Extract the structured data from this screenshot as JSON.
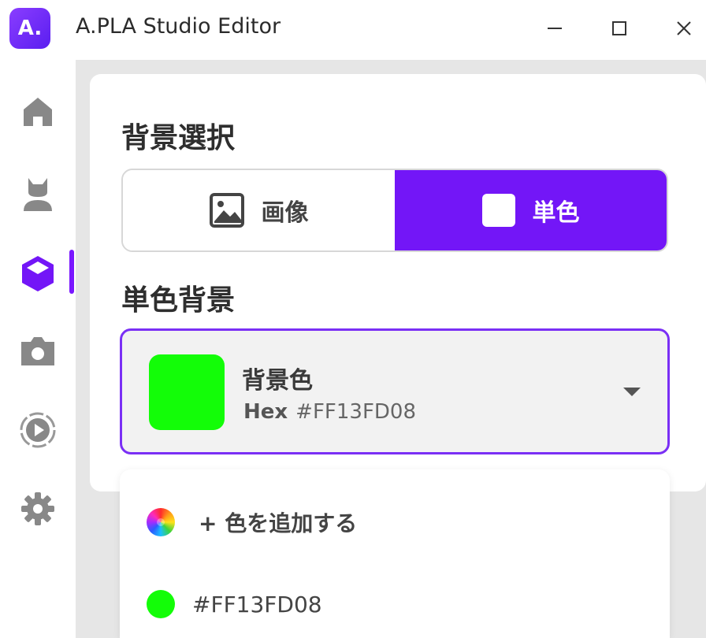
{
  "window": {
    "logo_text": "A.",
    "title": "A.PLA Studio Editor"
  },
  "sidebar": {
    "items": [
      {
        "icon": "home-icon"
      },
      {
        "icon": "avatar-icon"
      },
      {
        "icon": "cube-icon",
        "active": true
      },
      {
        "icon": "camera-icon"
      },
      {
        "icon": "play-icon"
      },
      {
        "icon": "gear-icon"
      }
    ]
  },
  "background": {
    "section_title": "背景選択",
    "options": {
      "image_label": "画像",
      "solid_label": "単色"
    },
    "selected": "solid"
  },
  "solid": {
    "section_title": "単色背景",
    "color_label": "背景色",
    "hex_prefix": "Hex",
    "hex_value": "#FF13FD08",
    "swatch_color": "#13FD08"
  },
  "dropdown": {
    "add_label": "+ 色を追加する",
    "colors": [
      {
        "label": "#FF13FD08",
        "color": "#13FD08"
      }
    ]
  },
  "colors": {
    "accent": "#7316F7",
    "background": "#E6E6E6"
  }
}
